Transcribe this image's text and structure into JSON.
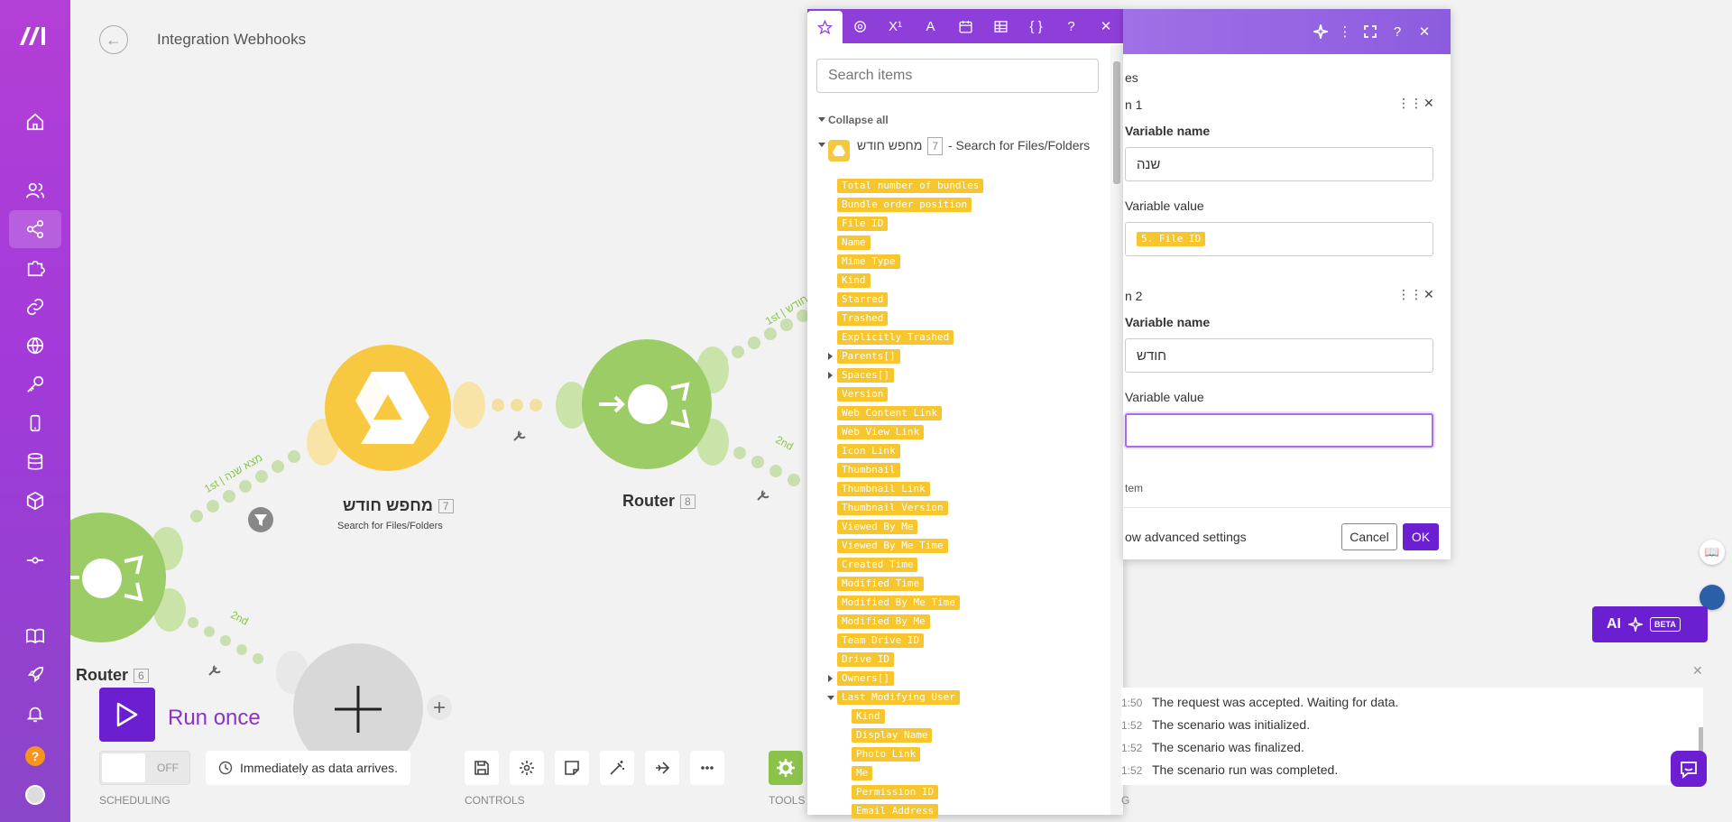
{
  "header": {
    "title": "Integration Webhooks"
  },
  "sidebar": {
    "help_label": "?"
  },
  "canvas": {
    "modules": [
      {
        "name": "Router",
        "num": "6"
      },
      {
        "name": "מחפש חודש",
        "num": "7",
        "subtitle": "Search for Files/Folders"
      },
      {
        "name": "Router",
        "num": "8"
      }
    ],
    "routes": {
      "r1": "1st",
      "r1_name": "מצא שנה",
      "r2": "2nd",
      "r3": "1st",
      "r3_name": "חודש",
      "r4": "2nd"
    }
  },
  "controls": {
    "run_label": "Run once",
    "toggle_state": "OFF",
    "schedule": "Immediately as data arrives.",
    "scheduling_label": "SCHEDULING",
    "controls_label": "CONTROLS",
    "tools_label": "TOOLS",
    "log_label": "G"
  },
  "mapping": {
    "search_placeholder": "Search items",
    "collapse_label": "Collapse all",
    "module_name": "מחפש חודש",
    "module_num": "7",
    "module_suffix": "- Search for Files/Folders",
    "items": [
      "Total number of bundles",
      "Bundle order position",
      "File ID",
      "Name",
      "Mime Type",
      "Kind",
      "Starred",
      "Trashed",
      "Explicitly Trashed",
      "Parents[]",
      "Spaces[]",
      "Version",
      "Web Content Link",
      "Web View Link",
      "Icon Link",
      "Thumbnail",
      "Thumbnail Link",
      "Thumbnail Version",
      "Viewed By Me",
      "Viewed By Me Time",
      "Created Time",
      "Modified Time",
      "Modified By Me Time",
      "Modified By Me",
      "Team Drive ID",
      "Drive ID",
      "Owners[]",
      "Last Modifying User"
    ],
    "sub_items": [
      "Kind",
      "Display Name",
      "Photo Link",
      "Me",
      "Permission ID",
      "Email Address"
    ]
  },
  "dialog": {
    "section_label": "es",
    "item1_label": "n 1",
    "item2_label": "n 2",
    "var_name_label": "Variable name",
    "var_value_label": "Variable value",
    "item1_name": "שנה",
    "item1_value_chip": "5. File ID",
    "item2_name": "חודש",
    "item2_value": "",
    "add_item": "tem",
    "advanced": "ow advanced settings",
    "cancel": "Cancel",
    "ok": "OK"
  },
  "ai": {
    "label": "AI",
    "beta": "BETA"
  },
  "log": {
    "rows": [
      {
        "time": "1:50",
        "text": "The request was accepted. Waiting for data."
      },
      {
        "time": "1:52",
        "text": "The scenario was initialized."
      },
      {
        "time": "1:52",
        "text": "The scenario was finalized."
      },
      {
        "time": "1:52",
        "text": "The scenario run was completed."
      }
    ]
  }
}
